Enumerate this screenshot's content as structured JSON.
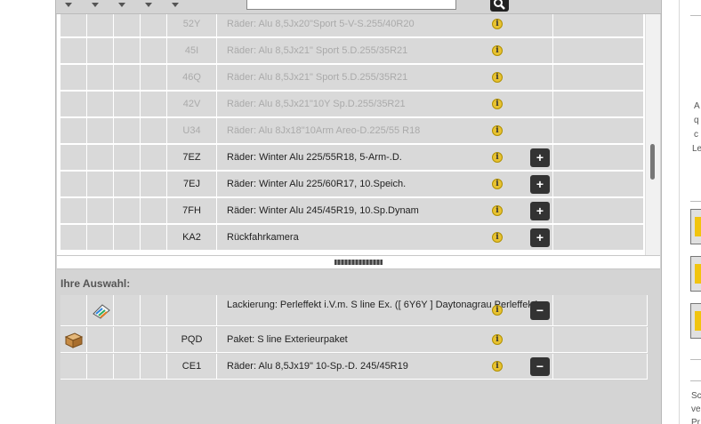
{
  "search": {
    "placeholder": ""
  },
  "options": [
    {
      "code": "52Y",
      "label": "Räder: Alu 8,5Jx20\"Sport 5-V-S.255/40R20",
      "available": false
    },
    {
      "code": "45I",
      "label": "Räder: Alu 8,5Jx21\" Sport 5.D.255/35R21",
      "available": false
    },
    {
      "code": "46Q",
      "label": "Räder: Alu 8,5Jx21\" Sport 5.D.255/35R21",
      "available": false
    },
    {
      "code": "42V",
      "label": "Räder: Alu 8,5Jx21\"10Y Sp.D.255/35R21",
      "available": false
    },
    {
      "code": "U34",
      "label": "Räder: Alu 8Jx18\"10Arm Areo-D.225/55 R18",
      "available": false
    },
    {
      "code": "7EZ",
      "label": "Räder: Winter Alu 225/55R18, 5-Arm-.D.",
      "available": true
    },
    {
      "code": "7EJ",
      "label": "Räder: Winter Alu 225/60R17, 10.Speich.",
      "available": true
    },
    {
      "code": "7FH",
      "label": "Räder: Winter Alu 245/45R19, 10.Sp.Dynam",
      "available": true
    },
    {
      "code": "KA2",
      "label": "Rückfahrkamera",
      "available": true
    }
  ],
  "selection": {
    "heading": "Ihre Auswahl:",
    "items": [
      {
        "code": "",
        "label": "Lackierung: Perleffekt i.V.m. S line Ex. ([ 6Y6Y ] Daytonagrau Perleffekt)",
        "icon": "paint-palette-icon",
        "removable": true
      },
      {
        "code": "PQD",
        "label": "Paket: S line Exterieurpaket",
        "icon": "package-box-icon",
        "removable": false
      },
      {
        "code": "CE1",
        "label": "Räder: Alu 8,5Jx19\" 10-Sp.-D. 245/45R19",
        "icon": "",
        "removable": true
      }
    ]
  },
  "right_panel": {
    "text_lines": [
      "A",
      "q",
      "c",
      "Le"
    ],
    "footer_lines": [
      "Sc",
      "ve",
      "Pr"
    ]
  },
  "colors": {
    "row_bg": "#d9d9d9",
    "panel_bg": "#d4d4d4",
    "info_icon": "#e8c230",
    "button": "#333333"
  }
}
